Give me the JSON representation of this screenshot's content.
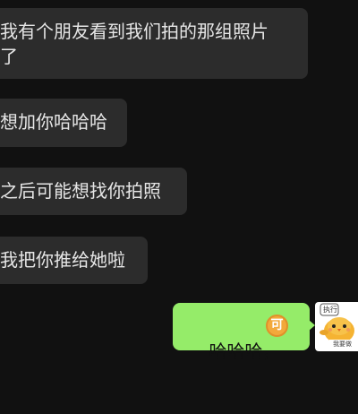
{
  "messages": [
    {
      "direction": "incoming",
      "text": "我有个朋友看到我们拍的那组照片\n了"
    },
    {
      "direction": "incoming",
      "text": "想加你哈哈哈"
    },
    {
      "direction": "incoming",
      "text": "之后可能想找你拍照"
    },
    {
      "direction": "incoming",
      "text": "我把你推给她啦"
    },
    {
      "direction": "outgoing",
      "text": "哈哈哈，",
      "emoji": "可"
    }
  ],
  "avatar": {
    "top_text": "执行",
    "bottom_text": "我要做"
  },
  "colors": {
    "background": "#111111",
    "incoming_bubble": "#2c2c2c",
    "outgoing_bubble": "#95ec69",
    "emoji": "#f2a93b"
  },
  "icons": {
    "emoji": "ok-emoji-icon",
    "avatar": "chick-sticker-avatar"
  }
}
